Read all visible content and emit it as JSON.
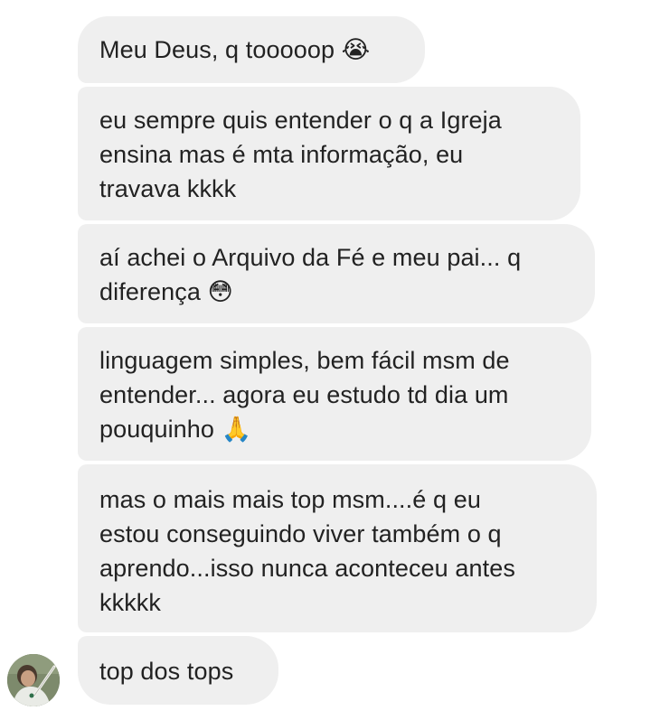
{
  "messages": [
    {
      "text": "Meu Deus, q tooooop 😭"
    },
    {
      "text": "eu sempre quis entender o q a Igreja\nensina mas é mta informação, eu\ntravava kkkk"
    },
    {
      "text": "aí achei o Arquivo da Fé e meu pai... q\ndiferença 😳"
    },
    {
      "text": "linguagem simples, bem fácil msm de\nentender... agora eu estudo td dia um\npouquinho 🙏"
    },
    {
      "text": "mas o mais mais top msm....é q eu\nestou conseguindo viver também o q\naprendo...isso nunca aconteceu antes\nkkkkk"
    },
    {
      "text": "top dos tops"
    }
  ],
  "colors": {
    "bubble_bg": "#efefef",
    "text": "#222222",
    "background": "#ffffff"
  },
  "avatar": {
    "icon": "user-avatar-photo"
  }
}
